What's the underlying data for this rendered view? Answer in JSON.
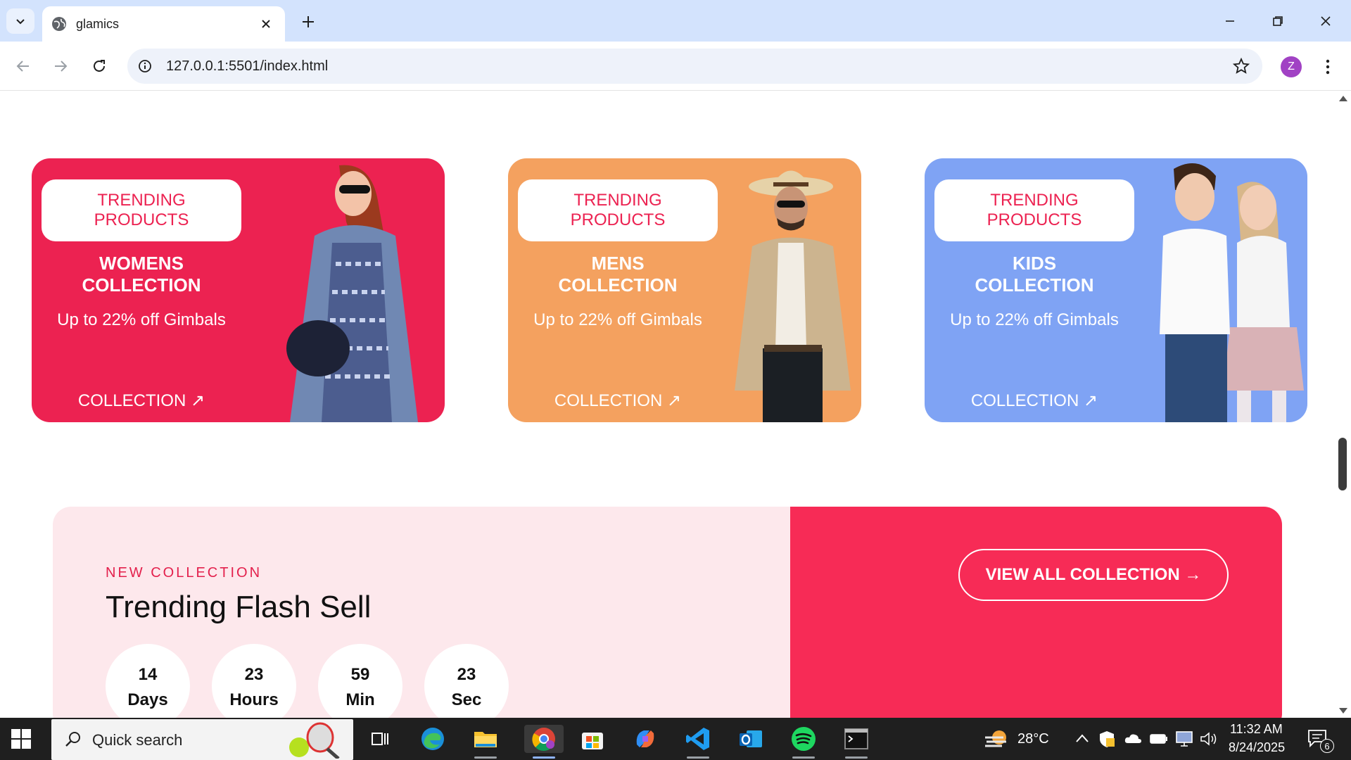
{
  "browser": {
    "tab_title": "glamics",
    "url": "127.0.0.1:5501/index.html",
    "profile_initial": "Z"
  },
  "cards": [
    {
      "badge": "TRENDING PRODUCTS",
      "title": "WOMENS COLLECTION",
      "subtitle": "Up to 22% off Gimbals",
      "link": "COLLECTION ↗",
      "color": "#ec2251"
    },
    {
      "badge": "TRENDING PRODUCTS",
      "title": "MENS COLLECTION",
      "subtitle": "Up to 22% off Gimbals",
      "link": "COLLECTION ↗",
      "color": "#f4a15f"
    },
    {
      "badge": "TRENDING PRODUCTS",
      "title": "KIDS COLLECTION",
      "subtitle": "Up to 22% off Gimbals",
      "link": "COLLECTION ↗",
      "color": "#7fa3f4"
    }
  ],
  "flash": {
    "eyebrow": "NEW COLLECTION",
    "title": "Trending Flash Sell",
    "countdown": [
      {
        "value": "14",
        "unit": "Days"
      },
      {
        "value": "23",
        "unit": "Hours"
      },
      {
        "value": "59",
        "unit": "Min"
      },
      {
        "value": "23",
        "unit": "Sec"
      }
    ],
    "cta": "VIEW ALL COLLECTION →"
  },
  "taskbar": {
    "search_placeholder": "Quick search",
    "weather": "28°C",
    "time": "11:32 AM",
    "date": "8/24/2025",
    "notifications": "6"
  }
}
